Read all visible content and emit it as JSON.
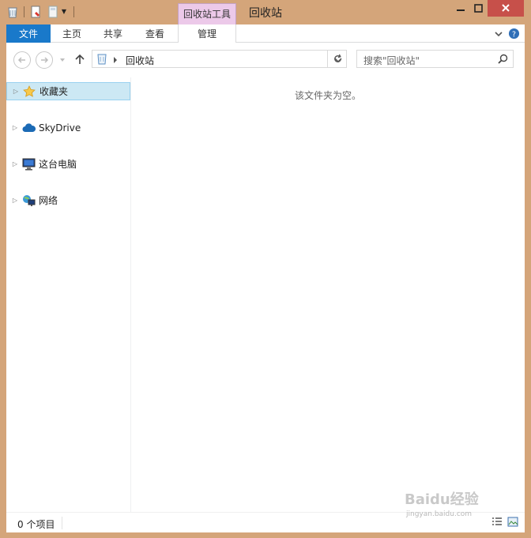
{
  "window": {
    "title": "回收站"
  },
  "context_tab": {
    "label": "回收站工具"
  },
  "ribbon": {
    "tabs": [
      {
        "label": "文件"
      },
      {
        "label": "主页"
      },
      {
        "label": "共享"
      },
      {
        "label": "查看"
      },
      {
        "label": "管理"
      }
    ]
  },
  "address": {
    "location": "回收站"
  },
  "search": {
    "placeholder": "搜索\"回收站\""
  },
  "nav_tree": {
    "items": [
      {
        "label": "收藏夹",
        "icon": "star-icon"
      },
      {
        "label": "SkyDrive",
        "icon": "cloud-icon"
      },
      {
        "label": "这台电脑",
        "icon": "computer-icon"
      },
      {
        "label": "网络",
        "icon": "network-icon"
      }
    ]
  },
  "content": {
    "empty_message": "该文件夹为空。"
  },
  "status": {
    "item_count": "0 个项目"
  },
  "watermark": {
    "logo": "Baidu经验",
    "url": "jingyan.baidu.com"
  },
  "colors": {
    "file_tab": "#1979ca",
    "context_tab": "#ecc9e9",
    "close_button": "#c7504a",
    "selection": "#cce8f4",
    "border": "#d4a57a"
  }
}
